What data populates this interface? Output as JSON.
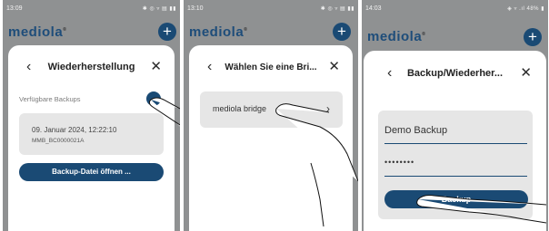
{
  "screen1": {
    "status_time": "13:09",
    "status_right": "✱ ◎ ▿ ▤ ▮▮",
    "logo": "mediola",
    "logo_mark": "®",
    "add_icon": "plus-icon",
    "title": "Wiederherstellung",
    "back_icon": "chevron-left-icon",
    "close_icon": "close-icon",
    "section_label": "Verfügbare Backups",
    "backup": {
      "date": "09. Januar 2024, 12:22:10",
      "id": "MMB_BC0000021A"
    },
    "open_button": "Backup-Datei öffnen ..."
  },
  "screen2": {
    "status_time": "13:10",
    "status_right": "✱ ◎ ▿ ▤ ▮▮",
    "logo": "mediola",
    "logo_mark": "®",
    "add_icon": "plus-icon",
    "title": "Wählen Sie eine Bri...",
    "back_icon": "chevron-left-icon",
    "close_icon": "close-icon",
    "bridge_item": "mediola bridge",
    "chevron_icon": "chevron-right-icon"
  },
  "screen3": {
    "status_time": "14:03",
    "status_right": "◈ ▿ .ıl 48% ▮",
    "logo": "mediola",
    "logo_mark": "®",
    "add_icon": "plus-icon",
    "title": "Backup/Wiederher...",
    "back_icon": "chevron-left-icon",
    "close_icon": "close-icon",
    "name_value": "Demo Backup",
    "password_value": "••••••••",
    "backup_button": "Backup"
  },
  "colors": {
    "brand": "#1a4a74",
    "overlay": "#8f9192",
    "card": "#e6e6e6"
  }
}
